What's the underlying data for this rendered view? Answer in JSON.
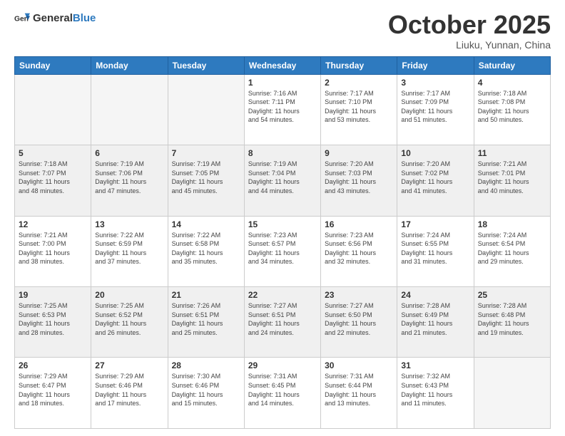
{
  "header": {
    "logo_general": "General",
    "logo_blue": "Blue",
    "month_title": "October 2025",
    "location": "Liuku, Yunnan, China"
  },
  "days_of_week": [
    "Sunday",
    "Monday",
    "Tuesday",
    "Wednesday",
    "Thursday",
    "Friday",
    "Saturday"
  ],
  "weeks": [
    [
      {
        "day": "",
        "info": ""
      },
      {
        "day": "",
        "info": ""
      },
      {
        "day": "",
        "info": ""
      },
      {
        "day": "1",
        "info": "Sunrise: 7:16 AM\nSunset: 7:11 PM\nDaylight: 11 hours\nand 54 minutes."
      },
      {
        "day": "2",
        "info": "Sunrise: 7:17 AM\nSunset: 7:10 PM\nDaylight: 11 hours\nand 53 minutes."
      },
      {
        "day": "3",
        "info": "Sunrise: 7:17 AM\nSunset: 7:09 PM\nDaylight: 11 hours\nand 51 minutes."
      },
      {
        "day": "4",
        "info": "Sunrise: 7:18 AM\nSunset: 7:08 PM\nDaylight: 11 hours\nand 50 minutes."
      }
    ],
    [
      {
        "day": "5",
        "info": "Sunrise: 7:18 AM\nSunset: 7:07 PM\nDaylight: 11 hours\nand 48 minutes."
      },
      {
        "day": "6",
        "info": "Sunrise: 7:19 AM\nSunset: 7:06 PM\nDaylight: 11 hours\nand 47 minutes."
      },
      {
        "day": "7",
        "info": "Sunrise: 7:19 AM\nSunset: 7:05 PM\nDaylight: 11 hours\nand 45 minutes."
      },
      {
        "day": "8",
        "info": "Sunrise: 7:19 AM\nSunset: 7:04 PM\nDaylight: 11 hours\nand 44 minutes."
      },
      {
        "day": "9",
        "info": "Sunrise: 7:20 AM\nSunset: 7:03 PM\nDaylight: 11 hours\nand 43 minutes."
      },
      {
        "day": "10",
        "info": "Sunrise: 7:20 AM\nSunset: 7:02 PM\nDaylight: 11 hours\nand 41 minutes."
      },
      {
        "day": "11",
        "info": "Sunrise: 7:21 AM\nSunset: 7:01 PM\nDaylight: 11 hours\nand 40 minutes."
      }
    ],
    [
      {
        "day": "12",
        "info": "Sunrise: 7:21 AM\nSunset: 7:00 PM\nDaylight: 11 hours\nand 38 minutes."
      },
      {
        "day": "13",
        "info": "Sunrise: 7:22 AM\nSunset: 6:59 PM\nDaylight: 11 hours\nand 37 minutes."
      },
      {
        "day": "14",
        "info": "Sunrise: 7:22 AM\nSunset: 6:58 PM\nDaylight: 11 hours\nand 35 minutes."
      },
      {
        "day": "15",
        "info": "Sunrise: 7:23 AM\nSunset: 6:57 PM\nDaylight: 11 hours\nand 34 minutes."
      },
      {
        "day": "16",
        "info": "Sunrise: 7:23 AM\nSunset: 6:56 PM\nDaylight: 11 hours\nand 32 minutes."
      },
      {
        "day": "17",
        "info": "Sunrise: 7:24 AM\nSunset: 6:55 PM\nDaylight: 11 hours\nand 31 minutes."
      },
      {
        "day": "18",
        "info": "Sunrise: 7:24 AM\nSunset: 6:54 PM\nDaylight: 11 hours\nand 29 minutes."
      }
    ],
    [
      {
        "day": "19",
        "info": "Sunrise: 7:25 AM\nSunset: 6:53 PM\nDaylight: 11 hours\nand 28 minutes."
      },
      {
        "day": "20",
        "info": "Sunrise: 7:25 AM\nSunset: 6:52 PM\nDaylight: 11 hours\nand 26 minutes."
      },
      {
        "day": "21",
        "info": "Sunrise: 7:26 AM\nSunset: 6:51 PM\nDaylight: 11 hours\nand 25 minutes."
      },
      {
        "day": "22",
        "info": "Sunrise: 7:27 AM\nSunset: 6:51 PM\nDaylight: 11 hours\nand 24 minutes."
      },
      {
        "day": "23",
        "info": "Sunrise: 7:27 AM\nSunset: 6:50 PM\nDaylight: 11 hours\nand 22 minutes."
      },
      {
        "day": "24",
        "info": "Sunrise: 7:28 AM\nSunset: 6:49 PM\nDaylight: 11 hours\nand 21 minutes."
      },
      {
        "day": "25",
        "info": "Sunrise: 7:28 AM\nSunset: 6:48 PM\nDaylight: 11 hours\nand 19 minutes."
      }
    ],
    [
      {
        "day": "26",
        "info": "Sunrise: 7:29 AM\nSunset: 6:47 PM\nDaylight: 11 hours\nand 18 minutes."
      },
      {
        "day": "27",
        "info": "Sunrise: 7:29 AM\nSunset: 6:46 PM\nDaylight: 11 hours\nand 17 minutes."
      },
      {
        "day": "28",
        "info": "Sunrise: 7:30 AM\nSunset: 6:46 PM\nDaylight: 11 hours\nand 15 minutes."
      },
      {
        "day": "29",
        "info": "Sunrise: 7:31 AM\nSunset: 6:45 PM\nDaylight: 11 hours\nand 14 minutes."
      },
      {
        "day": "30",
        "info": "Sunrise: 7:31 AM\nSunset: 6:44 PM\nDaylight: 11 hours\nand 13 minutes."
      },
      {
        "day": "31",
        "info": "Sunrise: 7:32 AM\nSunset: 6:43 PM\nDaylight: 11 hours\nand 11 minutes."
      },
      {
        "day": "",
        "info": ""
      }
    ]
  ]
}
